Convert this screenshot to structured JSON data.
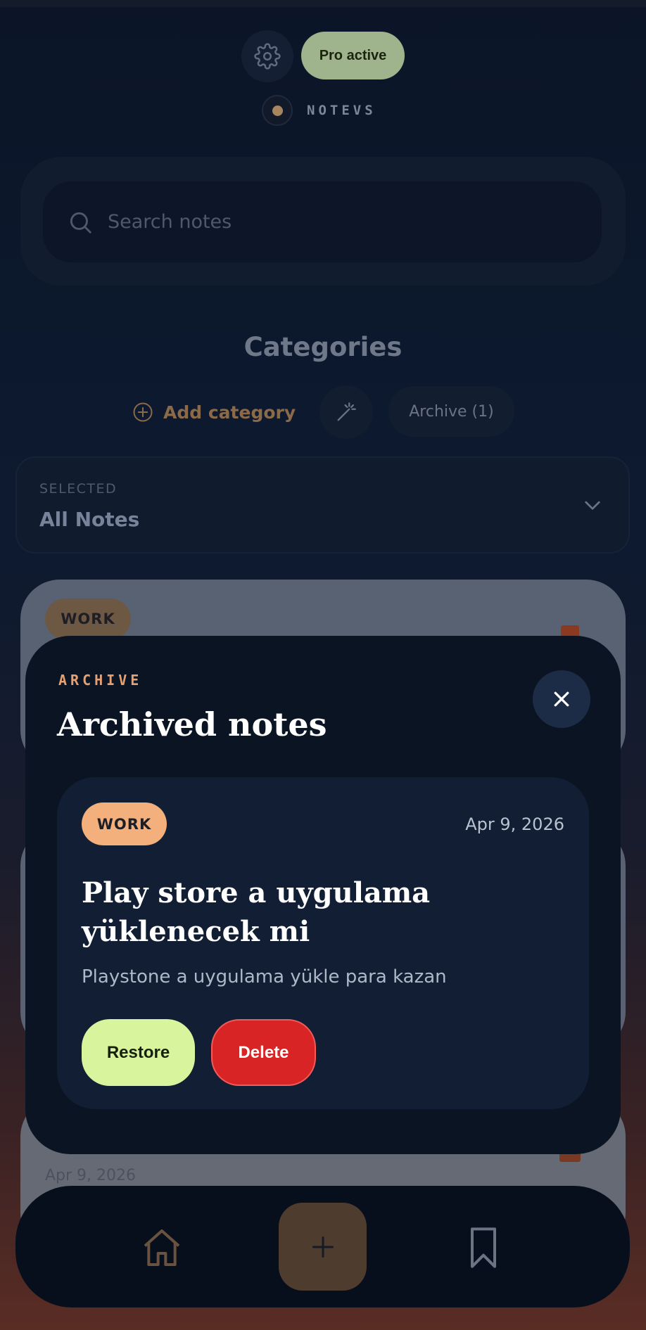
{
  "header": {
    "pro_badge": "Pro active",
    "brand": "NOTEVS"
  },
  "search": {
    "placeholder": "Search notes",
    "value": ""
  },
  "categories": {
    "title": "Categories",
    "add_label": "Add category",
    "archive_label": "Archive (1)"
  },
  "selected": {
    "label": "SELECTED",
    "value": "All Notes"
  },
  "background_notes": [
    {
      "tag": "WORK"
    },
    {
      "date": "Apr 9, 2026"
    }
  ],
  "archive_modal": {
    "eyebrow": "ARCHIVE",
    "title": "Archived notes",
    "note": {
      "tag": "WORK",
      "date": "Apr 9, 2026",
      "title": "Play store a uygulama yüklenecek mi",
      "body": "Playstone a uygulama yükle para kazan",
      "restore_label": "Restore",
      "delete_label": "Delete"
    }
  },
  "colors": {
    "accent_orange": "#f4b07c",
    "restore_green": "#d8f59d",
    "delete_red": "#d82424",
    "pro_green": "#9fb48c"
  },
  "icons": {
    "settings": "gear-icon",
    "search": "search-icon",
    "add_category": "plus-circle-icon",
    "magic": "magic-wand-icon",
    "dropdown": "chevron-down-icon",
    "close": "close-icon",
    "home": "home-icon",
    "add": "plus-icon",
    "bookmark": "bookmark-icon"
  }
}
